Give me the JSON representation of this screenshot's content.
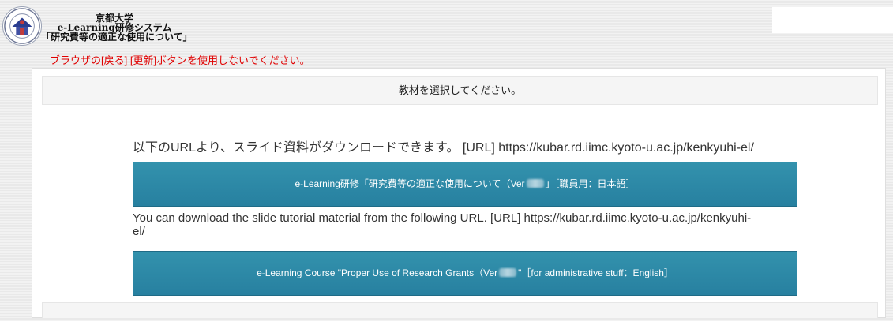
{
  "header": {
    "title_line1": "京都大学",
    "title_line2": "e-Learning研修システム",
    "title_line3": "「研究費等の適正な使用について」"
  },
  "warning": "ブラウザの[戻る] [更新]ボタンを使用しないでください。",
  "panel": {
    "header_text": "教材を選択してください。",
    "text_jp": "以下のURLより、スライド資料がダウンロードできます。 [URL] https://kubar.rd.iimc.kyoto-u.ac.jp/kenkyuhi-el/",
    "button_jp": {
      "prefix": "e-Learning研修「研究費等の適正な使用について（Ver",
      "suffix": "」［職員用：日本語］"
    },
    "text_en": "You can download the slide tutorial material from the following URL. [URL] https://kubar.rd.iimc.kyoto-u.ac.jp/kenkyuhi-el/",
    "button_en": {
      "prefix": "e-Learning Course \"Proper Use of Research Grants（Ver",
      "suffix": "\"［for administrative stuff：English］"
    }
  },
  "colors": {
    "warning": "#e00000",
    "button": "#2a86a4",
    "button_text": "#ffffff"
  }
}
